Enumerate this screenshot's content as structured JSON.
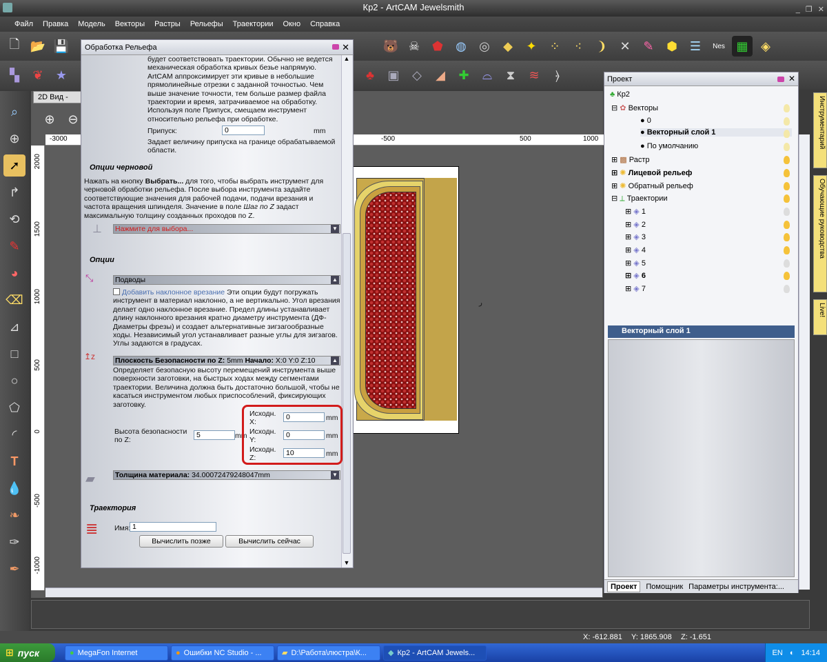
{
  "window": {
    "title": "Кр2 - ArtCAM Jewelsmith",
    "controls": [
      "_",
      "❐",
      "✕"
    ]
  },
  "menu": [
    "Файл",
    "Правка",
    "Модель",
    "Векторы",
    "Растры",
    "Рельефы",
    "Траектории",
    "Окно",
    "Справка"
  ],
  "view": {
    "tab_label": "2D Вид -"
  },
  "rulers": {
    "top": [
      "-3000",
      "-500",
      "500",
      "1000"
    ],
    "left": [
      "2000",
      "1500",
      "1000",
      "500",
      "0",
      "-500",
      "-1000"
    ]
  },
  "dialog": {
    "title": "Обработка Рельефа",
    "intro_text": "будет соответствовать траектории. Обычно не ведется механическая обработка кривых безье напрямую. ArtCAM аппроксимирует эти кривые в небольшие прямолинейные отрезки с заданной точностью. Чем выше значение точности, тем больше размер файла траектории и время, затрачиваемое на обработку. Используя поле Припуск, смещаем инструмент относительно рельефа при обработке.",
    "allowance_label": "Припуск:",
    "allowance_value": "0",
    "allowance_unit": "mm",
    "allowance_note": "Задает величину припуска на границе обрабатываемой области.",
    "rough_header": "Опции черновой",
    "rough_text_1": "Нажать на кнопку ",
    "rough_text_bold": "Выбрать...",
    "rough_text_2": " для того, чтобы выбрать инструмент для черновой обработки рельефа. После выбора инструмента задайте соответствующие значения для рабочей подачи, подачи врезания и частота вращения шпинделя. Значение в поле ",
    "rough_text_italic": "Шаг по Z",
    "rough_text_3": " задаст максимальную толщину созданных проходов по Z.",
    "tool_select_label": "Нажмите для выбора...",
    "options_header": "Опции",
    "leadin_bar": "Подводы",
    "ramp_checkbox_label": "Добавить наклонное врезание",
    "ramp_text": " Эти опции будут погружать инструмент в материал наклонно, а не вертикально. Угол врезания делает одно наклонное врезание. Предел длины устанавливает длину наклонного врезания кратно диаметру инструмента (ДФ-Диаметры фрезы) и создает альтернативные зигзагообразные ходы. Независимый угол устанавливает разные углы для зигзагов. Углы задаются в градусах.",
    "safez_bar_bold": "Плоскость Безопасности по Z:",
    "safez_bar_rest": " 5mm ",
    "safez_bar_start": "Начало:",
    "safez_bar_coords": " X:0 Y:0 Z:10",
    "safez_text": "Определяет безопасную высоту перемещений инструмента выше поверхности заготовки, на быстрых ходах между сегментами траектории. Величина должна быть достаточно большой, чтобы не касаться инструментом любых приспособлений, фиксирующих заготовку.",
    "safez_height_label": "Высота безопасности по Z:",
    "safez_height_value": "5",
    "safez_height_unit": "mm",
    "home": [
      {
        "label": "Исходн. X:",
        "value": "0",
        "unit": "mm"
      },
      {
        "label": "Исходн. Y:",
        "value": "0",
        "unit": "mm"
      },
      {
        "label": "Исходн. Z:",
        "value": "10",
        "unit": "mm"
      }
    ],
    "thickness_bold": "Толщина материала:",
    "thickness_value": " 34.00072479248047mm",
    "toolpath_header": "Траектория",
    "name_label": "Имя:",
    "name_value": "1",
    "btn_later": "Вычислить позже",
    "btn_now": "Вычислить сейчас"
  },
  "project": {
    "title": "Проект",
    "root": "Кр2",
    "vectors": "Векторы",
    "vector_layers": [
      "0",
      "Векторный слой 1",
      "По умолчанию"
    ],
    "raster": "Растр",
    "front_relief": "Лицевой рельеф",
    "back_relief": "Обратный рельеф",
    "toolpaths": "Траектории",
    "toolpath_items": [
      "1",
      "2",
      "3",
      "4",
      "5",
      "6",
      "7"
    ],
    "active_layer": "Векторный слой 1",
    "tabs": [
      "Проект",
      "Помощник",
      "Параметры инструмента:..."
    ]
  },
  "side_tabs": [
    "Инструментарий",
    "Обучающие руководства",
    "Live!"
  ],
  "status": {
    "x": "X: -612.881",
    "y": "Y: 1865.908",
    "z": "Z: -1.651"
  },
  "taskbar": {
    "start": "пуск",
    "tasks": [
      "MegaFon Internet",
      "Ошибки NC Studio - ...",
      "D:\\Работа\\люстра\\К...",
      "Кр2 - ArtCAM Jewels..."
    ],
    "lang": "EN",
    "clock": "14:14"
  },
  "canvas_note": "ر"
}
